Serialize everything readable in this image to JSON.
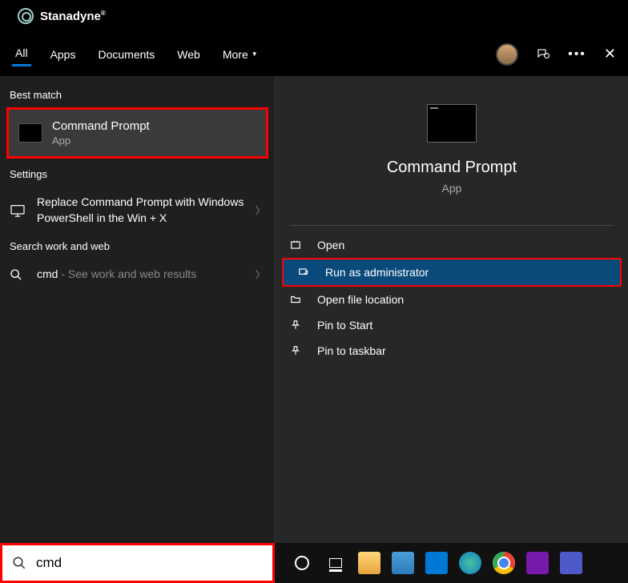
{
  "brand": {
    "name": "Stanadyne"
  },
  "tabs": {
    "all": "All",
    "apps": "Apps",
    "documents": "Documents",
    "web": "Web",
    "more": "More"
  },
  "sections": {
    "best_match": "Best match",
    "settings": "Settings",
    "search_work_web": "Search work and web"
  },
  "best_match_item": {
    "title": "Command Prompt",
    "subtitle": "App"
  },
  "settings_item": {
    "text": "Replace Command Prompt with Windows PowerShell in the Win + X"
  },
  "web_item": {
    "query": "cmd",
    "hint": " - See work and web results"
  },
  "preview": {
    "title": "Command Prompt",
    "subtitle": "App"
  },
  "actions": {
    "open": "Open",
    "run_admin": "Run as administrator",
    "open_location": "Open file location",
    "pin_start": "Pin to Start",
    "pin_taskbar": "Pin to taskbar"
  },
  "search": {
    "value": "cmd"
  }
}
